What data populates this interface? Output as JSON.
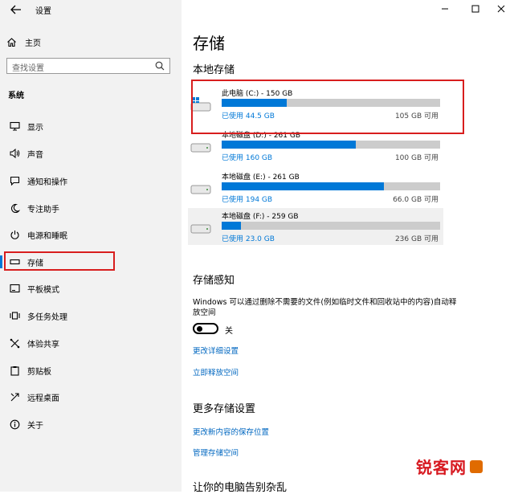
{
  "window": {
    "title": "设置",
    "minimize": "—",
    "maximize": "☐",
    "close": "✕"
  },
  "sidebar": {
    "home_label": "主页",
    "search_placeholder": "查找设置",
    "section_label": "系统",
    "items": [
      {
        "label": "显示",
        "icon": "display-icon"
      },
      {
        "label": "声音",
        "icon": "sound-icon"
      },
      {
        "label": "通知和操作",
        "icon": "notification-icon"
      },
      {
        "label": "专注助手",
        "icon": "moon-icon"
      },
      {
        "label": "电源和睡眠",
        "icon": "power-icon"
      },
      {
        "label": "存储",
        "icon": "storage-icon",
        "active": true
      },
      {
        "label": "平板模式",
        "icon": "tablet-icon"
      },
      {
        "label": "多任务处理",
        "icon": "multitask-icon"
      },
      {
        "label": "体验共享",
        "icon": "share-icon"
      },
      {
        "label": "剪贴板",
        "icon": "clipboard-icon"
      },
      {
        "label": "远程桌面",
        "icon": "remote-icon"
      },
      {
        "label": "关于",
        "icon": "info-icon"
      }
    ]
  },
  "main": {
    "title": "存储",
    "local_storage_heading": "本地存储",
    "drives": [
      {
        "name": "此电脑 (C:) - 150 GB",
        "used": "已使用 44.5 GB",
        "free": "105 GB 可用",
        "used_fraction": 0.297,
        "icon": "windows-drive-icon"
      },
      {
        "name": "本地磁盘 (D:) - 261 GB",
        "used": "已使用 160 GB",
        "free": "100 GB 可用",
        "used_fraction": 0.613,
        "icon": "drive-icon"
      },
      {
        "name": "本地磁盘 (E:) - 261 GB",
        "used": "已使用 194 GB",
        "free": "66.0 GB 可用",
        "used_fraction": 0.743,
        "icon": "drive-icon"
      },
      {
        "name": "本地磁盘 (F:) - 259 GB",
        "used": "已使用 23.0 GB",
        "free": "236 GB 可用",
        "used_fraction": 0.089,
        "icon": "drive-icon"
      }
    ],
    "storage_sense_heading": "存储感知",
    "storage_sense_desc": "Windows 可以通过删除不需要的文件(例如临时文件和回收站中的内容)自动释放空间",
    "toggle_state": "关",
    "links": {
      "change_config": "更改详细设置",
      "free_now": "立即释放空间"
    },
    "more_heading": "更多存储设置",
    "more_links": {
      "save_location": "更改新内容的保存位置",
      "manage_spaces": "管理存储空间"
    },
    "bottom_heading": "让你的电脑告别杂乱"
  },
  "watermark": {
    "text": "锐客网"
  },
  "colors": {
    "accent": "#0078d7",
    "highlight_box": "#d81e1e",
    "sidebar_bg": "#f2f2f2",
    "bar_bg": "#cccccc"
  }
}
